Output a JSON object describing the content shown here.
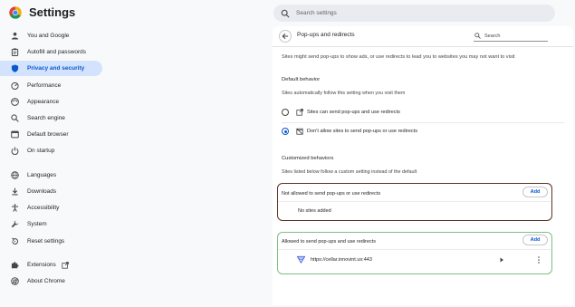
{
  "header": {
    "app_title": "Settings",
    "search_placeholder": "Search settings"
  },
  "sidebar": {
    "items": [
      {
        "label": "You and Google",
        "icon": "person-icon"
      },
      {
        "label": "Autofill and passwords",
        "icon": "clipboard-icon"
      },
      {
        "label": "Privacy and security",
        "icon": "shield-icon",
        "active": true
      },
      {
        "label": "Performance",
        "icon": "speedometer-icon"
      },
      {
        "label": "Appearance",
        "icon": "palette-icon"
      },
      {
        "label": "Search engine",
        "icon": "search-icon"
      },
      {
        "label": "Default browser",
        "icon": "browser-icon"
      },
      {
        "label": "On startup",
        "icon": "power-icon"
      },
      {
        "label": "Languages",
        "icon": "globe-icon"
      },
      {
        "label": "Downloads",
        "icon": "download-icon"
      },
      {
        "label": "Accessibility",
        "icon": "accessibility-icon"
      },
      {
        "label": "System",
        "icon": "wrench-icon"
      },
      {
        "label": "Reset settings",
        "icon": "reset-icon"
      },
      {
        "label": "Extensions",
        "icon": "puzzle-icon"
      },
      {
        "label": "About Chrome",
        "icon": "chrome-icon"
      }
    ]
  },
  "main": {
    "title": "Pop-ups and redirects",
    "search_placeholder": "Search",
    "description": "Sites might send pop-ups to show ads, or use redirects to lead you to websites you may not want to visit",
    "default_behavior": {
      "heading": "Default behavior",
      "subheading": "Sites automatically follow this setting when you visit them",
      "options": [
        {
          "label": "Sites can send pop-ups and use redirects",
          "icon": "open-in-new-icon",
          "checked": false
        },
        {
          "label": "Don't allow sites to send pop-ups or use redirects",
          "icon": "popup-blocked-icon",
          "checked": true
        }
      ]
    },
    "customized": {
      "heading": "Customized behaviors",
      "subheading": "Sites listed below follow a custom setting instead of the default",
      "not_allowed": {
        "title": "Not allowed to send pop-ups or use redirects",
        "add_label": "Add",
        "empty_text": "No sites added"
      },
      "allowed": {
        "title": "Allowed to send pop-ups and use redirects",
        "add_label": "Add",
        "sites": [
          {
            "url": "https://cellar.innovint.us:443"
          }
        ]
      }
    }
  },
  "colors": {
    "accent": "#0b57d0",
    "active_nav_bg": "#d3e3fd",
    "blocked_outline": "#5a3222",
    "allowed_outline": "#7bc083"
  }
}
